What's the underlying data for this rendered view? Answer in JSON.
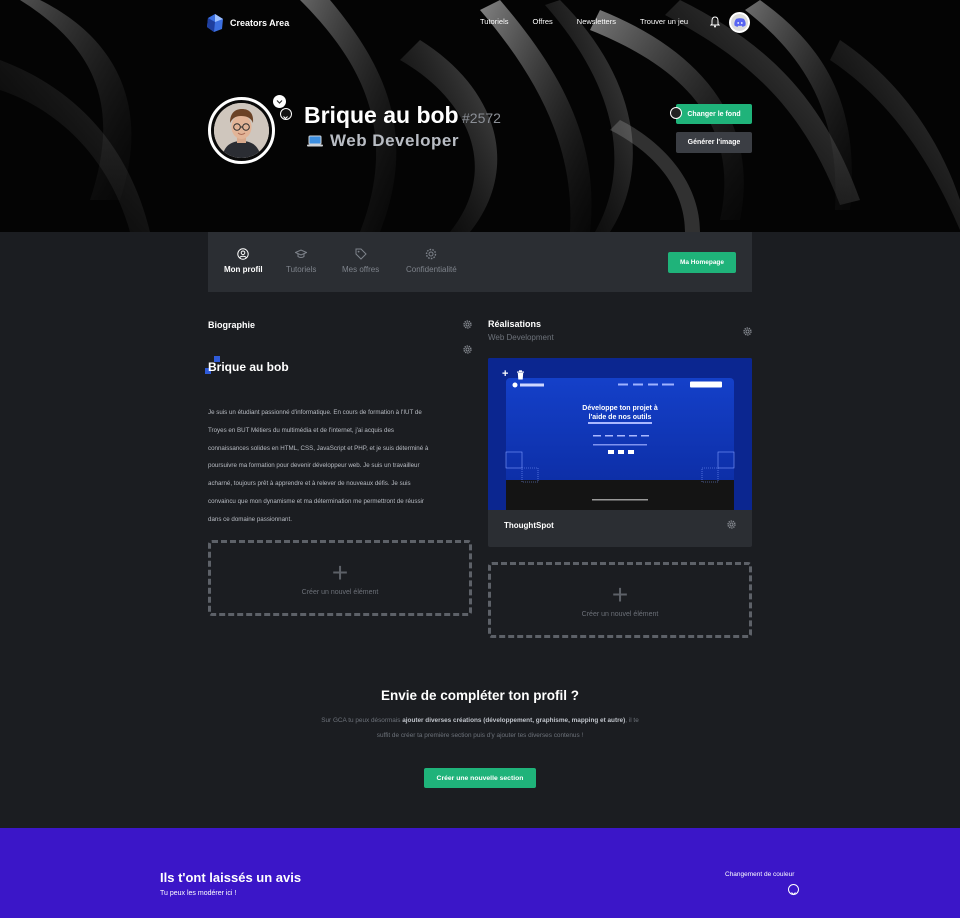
{
  "nav": {
    "brand": "Creators Area",
    "links": [
      "Tutoriels",
      "Offres",
      "Newsletters",
      "Trouver un jeu"
    ]
  },
  "profile": {
    "name": "Brique au bob",
    "tag": "#2572",
    "job": "Web Developer",
    "change_bg_label": "Changer le fond",
    "generate_image_label": "Générer l'image"
  },
  "tabs": [
    {
      "label": "Mon profil",
      "icon": "user-circle-icon",
      "active": true
    },
    {
      "label": "Tutoriels",
      "icon": "graduation-cap-icon",
      "active": false
    },
    {
      "label": "Mes offres",
      "icon": "tags-icon",
      "active": false
    },
    {
      "label": "Confidentialité",
      "icon": "gear-icon",
      "active": false
    }
  ],
  "homepage_label": "Ma Homepage",
  "biography": {
    "title": "Biographie",
    "heading": "Brique au bob",
    "lines": [
      "Je suis un étudiant passionné d'informatique. En cours de formation à l'IUT de",
      "Troyes en BUT Métiers du multimédia et de l'internet, j'ai acquis des",
      "connaissances solides en HTML, CSS, JavaScript et PHP, et je suis déterminé à",
      "poursuivre ma formation pour devenir développeur web. Je suis un travailleur",
      "acharné, toujours prêt à apprendre et à relever de nouveaux défis. Je suis",
      "convaincu que mon dynamisme et ma détermination me permettront de réussir",
      "dans ce domaine passionnant."
    ],
    "add_label": "Créer un nouvel élément"
  },
  "realisations": {
    "title": "Réalisations",
    "subtitle": "Web Development",
    "card_title": "ThoughtSpot",
    "preview_heading_1": "Développe ton projet à",
    "preview_heading_2": "l'aide de nos outils",
    "add_label": "Créer un nouvel élément"
  },
  "cta": {
    "title": "Envie de compléter ton profil ?",
    "text_1": "Sur GCA tu peux désormais ",
    "text_bold": "ajouter diverses créations (développement, graphisme, mapping et autre)",
    "text_2": ", il te suffit de créer ta première section puis d'y ajouter tes diverses contenus !",
    "button": "Créer une nouvelle section"
  },
  "reviews": {
    "title": "Ils t'ont laissés un avis",
    "subtitle": "Tu peux les modérer ici !",
    "color_label": "Changement de couleur"
  },
  "colors": {
    "accent": "#1fb37a",
    "background": "#1b1d21",
    "panel": "#2b2e33",
    "reviews_bg": "#3b16c8"
  }
}
